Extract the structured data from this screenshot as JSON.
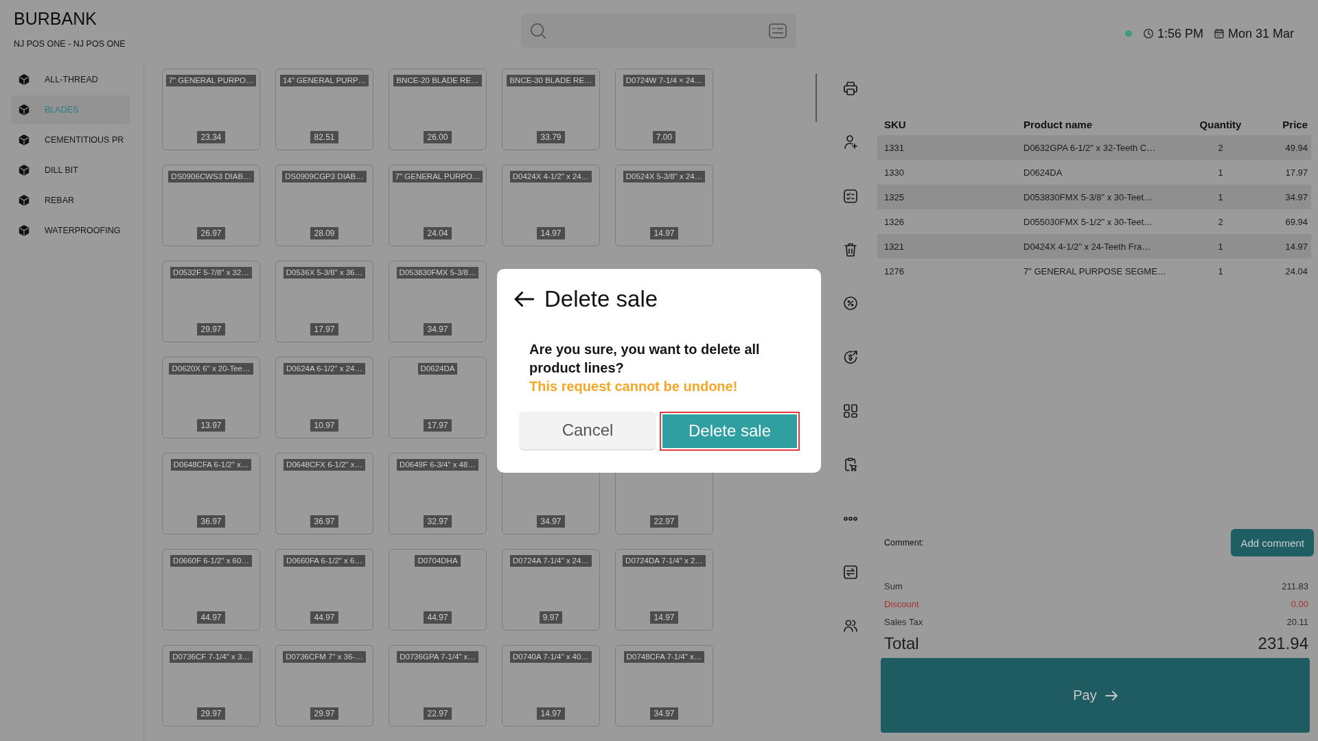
{
  "store": {
    "name": "BURBANK",
    "register": "NJ POS ONE - NJ POS ONE"
  },
  "status": {
    "online": true,
    "time": "1:56 PM",
    "date": "Mon 31 Mar"
  },
  "categories": [
    {
      "label": "ALL-THREAD",
      "selected": false
    },
    {
      "label": "BLADES",
      "selected": true
    },
    {
      "label": "CEMENTITIOUS PR",
      "selected": false
    },
    {
      "label": "DILL BIT",
      "selected": false
    },
    {
      "label": "REBAR",
      "selected": false
    },
    {
      "label": "WATERPROOFING",
      "selected": false
    }
  ],
  "product_rows": [
    [
      {
        "name": "7\" GENERAL PURPO…",
        "price": "23.34"
      },
      {
        "name": "14\" GENERAL PURP…",
        "price": "82.51"
      },
      {
        "name": "BNCE-20 BLADE RE…",
        "price": "26.00"
      },
      {
        "name": "BNCE-30 BLADE RE…",
        "price": "33.79"
      },
      {
        "name": "D0724W 7-1/4 × 24…",
        "price": "7.00"
      }
    ],
    [
      {
        "name": "DS0906CWS3 DIAB…",
        "price": "26.97"
      },
      {
        "name": "DS0909CGP3 DIAB…",
        "price": "28.09"
      },
      {
        "name": "7\" GENERAL PURPO…",
        "price": "24.04"
      },
      {
        "name": "D0424X 4-1/2\" x 24…",
        "price": "14.97"
      },
      {
        "name": "D0524X 5-3/8\" x 24…",
        "price": "14.97"
      }
    ],
    [
      {
        "name": "D0532F 5-7/8\" x 32…",
        "price": "29.97"
      },
      {
        "name": "D0536X 5-3/8\" x 36…",
        "price": "17.97"
      },
      {
        "name": "D053830FMX 5-3/8…",
        "price": "34.97"
      }
    ],
    [
      {
        "name": "D0620X 6\" x 20-Tee…",
        "price": "13.97"
      },
      {
        "name": "D0624A 6-1/2\" x 24…",
        "price": "10.97"
      },
      {
        "name": "D0624DA",
        "price": "17.97"
      }
    ],
    [
      {
        "name": "D0648CFA 6-1/2\" x…",
        "price": "36.97"
      },
      {
        "name": "D0648CFX 6-1/2\" x…",
        "price": "36.97"
      },
      {
        "name": "D0649F 6-3/4\" x 48…",
        "price": "32.97"
      },
      {
        "price": "34.97"
      },
      {
        "price": "22.97"
      }
    ],
    [
      {
        "name": "D0660F 6-1/2\" x 60…",
        "price": "44.97"
      },
      {
        "name": "D0660FA 6-1/2\" x 6…",
        "price": "44.97"
      },
      {
        "name": "D0704DHA",
        "price": "44.97"
      },
      {
        "name": "D0724A 7-1/4\" x 24…",
        "price": "9.97"
      },
      {
        "name": "D0724DA 7-1/4\" x 2…",
        "price": "14.97"
      }
    ],
    [
      {
        "name": "D0736CF 7-1/4\" x 3…",
        "price": "29.97"
      },
      {
        "name": "D0736CFM 7\" x 36-…",
        "price": "29.97"
      },
      {
        "name": "D0736GPA 7-1/4\" x…",
        "price": "22.97"
      },
      {
        "name": "D0740A 7-1/4\" x 40…",
        "price": "14.97"
      },
      {
        "name": "D0748CFA 7-1/4\" x…",
        "price": "34.97"
      }
    ]
  ],
  "cart": {
    "columns": [
      "SKU",
      "Product name",
      "Quantity",
      "Price"
    ],
    "rows": [
      {
        "sku": "1331",
        "name": "D0632GPA 6-1/2\" x 32-Teeth C…",
        "quantity": "2",
        "price": "49.94"
      },
      {
        "sku": "1330",
        "name": "D0624DA",
        "quantity": "1",
        "price": "17.97"
      },
      {
        "sku": "1325",
        "name": "D053830FMX 5-3/8\" x 30-Teet…",
        "quantity": "1",
        "price": "34.97"
      },
      {
        "sku": "1326",
        "name": "D055030FMX 5-1/2\" x 30-Teet…",
        "quantity": "2",
        "price": "69.94"
      },
      {
        "sku": "1321",
        "name": "D0424X 4-1/2\" x 24-Teeth Fra…",
        "quantity": "1",
        "price": "14.97"
      },
      {
        "sku": "1276",
        "name": "7\" GENERAL PURPOSE SEGME…",
        "quantity": "1",
        "price": "24.04"
      }
    ]
  },
  "comment": {
    "label": "Comment:",
    "button": "Add comment"
  },
  "totals": [
    {
      "label": "Sum",
      "value": "211.83",
      "kind": "plain"
    },
    {
      "label": "Discount",
      "value": "0.00",
      "kind": "discount"
    },
    {
      "label": "Sales Tax",
      "value": "20.11",
      "kind": "plain"
    },
    {
      "label": "Total",
      "value": "231.94",
      "kind": "total"
    }
  ],
  "pay_button": "Pay",
  "dialog": {
    "title": "Delete sale",
    "message": "Are you sure, you want to delete all product lines?",
    "warning": "This request cannot be undone!",
    "buttons": [
      {
        "label": "Cancel",
        "kind": "secondary",
        "highlighted": false
      },
      {
        "label": "Delete sale",
        "kind": "primary",
        "highlighted": true
      }
    ]
  }
}
